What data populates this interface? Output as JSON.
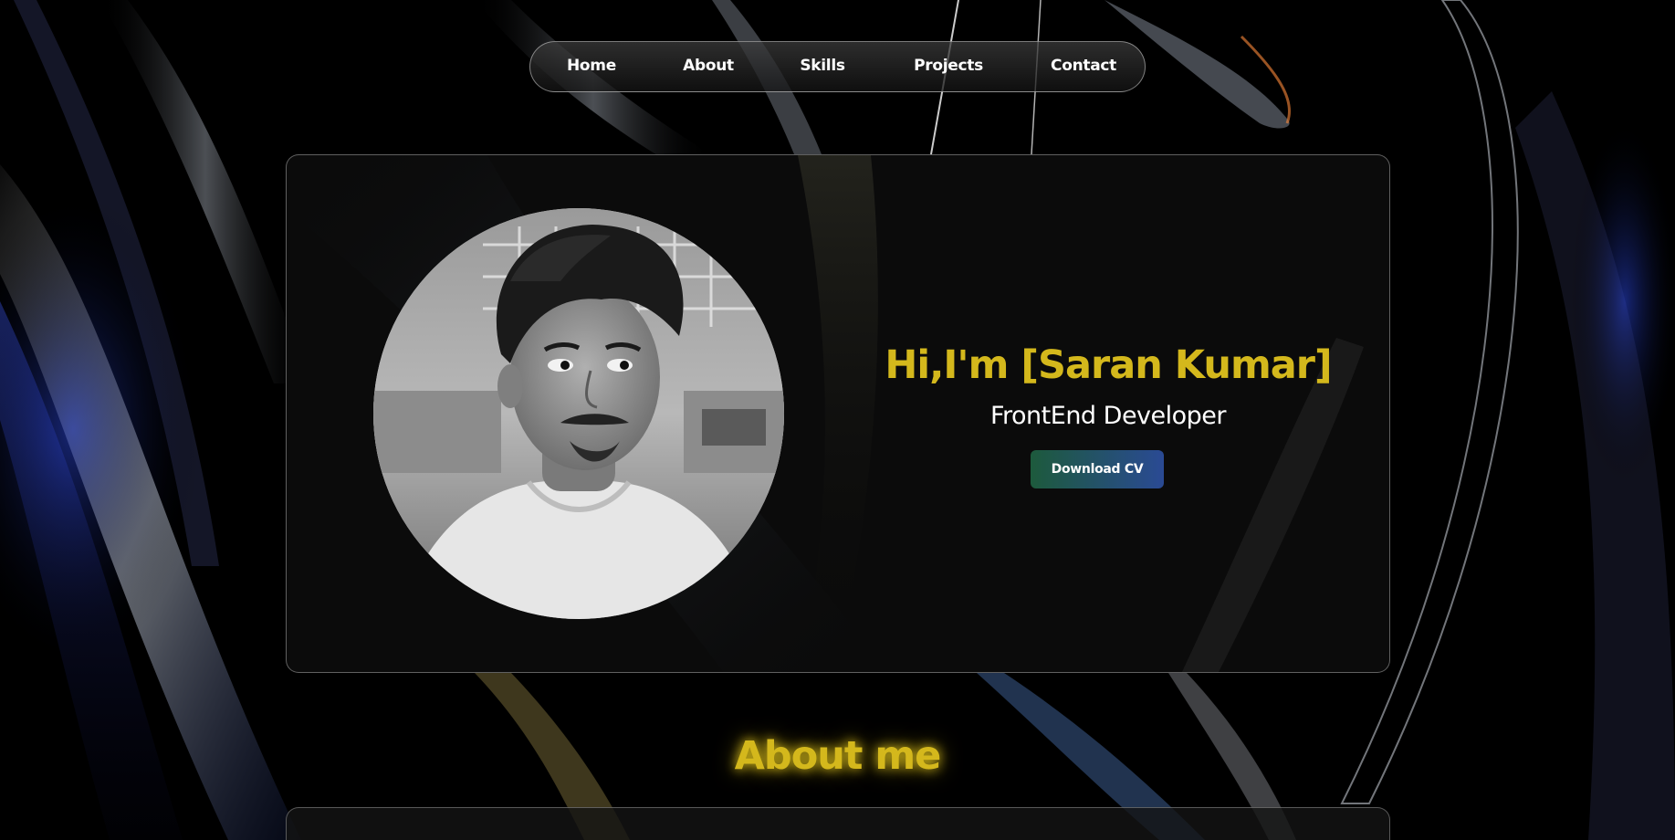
{
  "nav": {
    "items": [
      {
        "label": "Home"
      },
      {
        "label": "About"
      },
      {
        "label": "Skills"
      },
      {
        "label": "Projects"
      },
      {
        "label": "Contact"
      }
    ]
  },
  "hero": {
    "title": "Hi,I'm [Saran Kumar]",
    "subtitle": "FrontEnd Developer",
    "cv_button": "Download CV"
  },
  "about": {
    "heading": "About me"
  },
  "colors": {
    "accent": "#d4b81c",
    "button_start": "#1d5a3c",
    "button_end": "#2a4a94",
    "background": "#000000"
  }
}
